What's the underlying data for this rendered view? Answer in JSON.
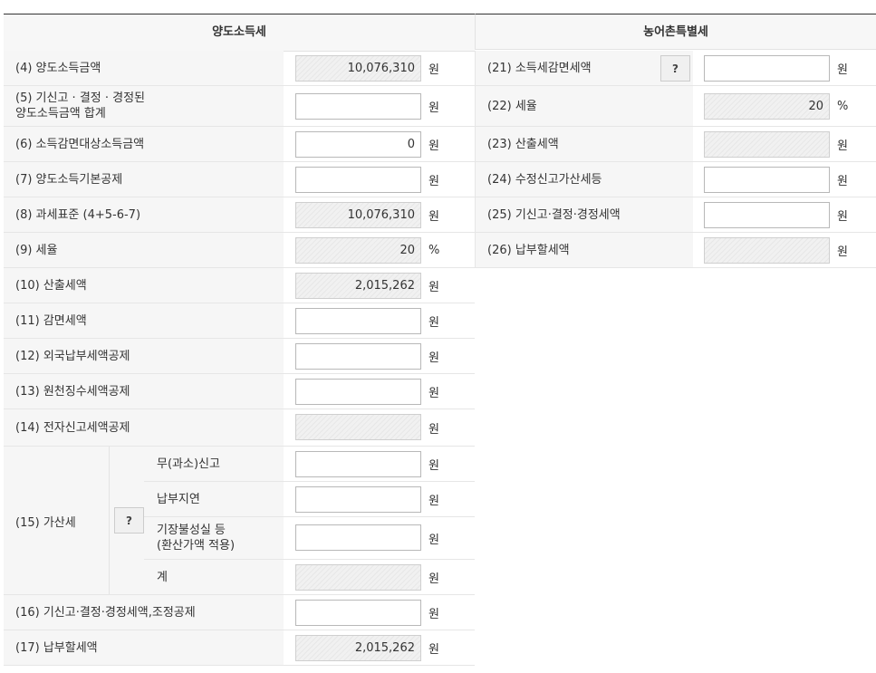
{
  "headers": {
    "left": "양도소득세",
    "right": "농어촌특별세"
  },
  "help_label": "?",
  "left_rows": [
    {
      "label": "(4) 양도소득금액",
      "value": "10,076,310",
      "unit": "원",
      "readonly": true
    },
    {
      "label": "(5) 기신고 · 결정 · 경정된\n양도소득금액 합계",
      "value": "",
      "unit": "원",
      "readonly": false
    },
    {
      "label": "(6) 소득감면대상소득금액",
      "value": "0",
      "unit": "원",
      "readonly": false
    },
    {
      "label": "(7) 양도소득기본공제",
      "value": "",
      "unit": "원",
      "readonly": false
    },
    {
      "label": "(8) 과세표준 (4+5-6-7)",
      "value": "10,076,310",
      "unit": "원",
      "readonly": true
    },
    {
      "label": "(9) 세율",
      "value": "20",
      "unit": "%",
      "readonly": true
    },
    {
      "label": "(10) 산출세액",
      "value": "2,015,262",
      "unit": "원",
      "readonly": true
    },
    {
      "label": "(11) 감면세액",
      "value": "",
      "unit": "원",
      "readonly": false
    },
    {
      "label": "(12) 외국납부세액공제",
      "value": "",
      "unit": "원",
      "readonly": false
    },
    {
      "label": "(13) 원천징수세액공제",
      "value": "",
      "unit": "원",
      "readonly": false
    },
    {
      "label": "(14) 전자신고세액공제",
      "value": "",
      "unit": "원",
      "readonly": true
    }
  ],
  "penalty": {
    "label": "(15) 가산세",
    "rows": [
      {
        "label": "무(과소)신고",
        "value": "",
        "unit": "원",
        "readonly": false
      },
      {
        "label": "납부지연",
        "value": "",
        "unit": "원",
        "readonly": false
      },
      {
        "label": "기장불성실 등\n(환산가액 적용)",
        "value": "",
        "unit": "원",
        "readonly": false
      },
      {
        "label": "계",
        "value": "",
        "unit": "원",
        "readonly": true
      }
    ]
  },
  "bottom_rows": [
    {
      "label": "(16) 기신고·결정·경정세액,조정공제",
      "value": "",
      "unit": "원",
      "readonly": false
    },
    {
      "label": "(17) 납부할세액",
      "value": "2,015,262",
      "unit": "원",
      "readonly": true
    }
  ],
  "right_rows": [
    {
      "label": "(21) 소득세감면세액",
      "value": "",
      "unit": "원",
      "readonly": false,
      "help": true
    },
    {
      "label": "(22) 세율",
      "value": "20",
      "unit": "%",
      "readonly": true
    },
    {
      "label": "(23) 산출세액",
      "value": "",
      "unit": "원",
      "readonly": true
    },
    {
      "label": "(24) 수정신고가산세등",
      "value": "",
      "unit": "원",
      "readonly": false
    },
    {
      "label": "(25) 기신고·결정·경정세액",
      "value": "",
      "unit": "원",
      "readonly": false
    },
    {
      "label": "(26) 납부할세액",
      "value": "",
      "unit": "원",
      "readonly": true
    }
  ]
}
